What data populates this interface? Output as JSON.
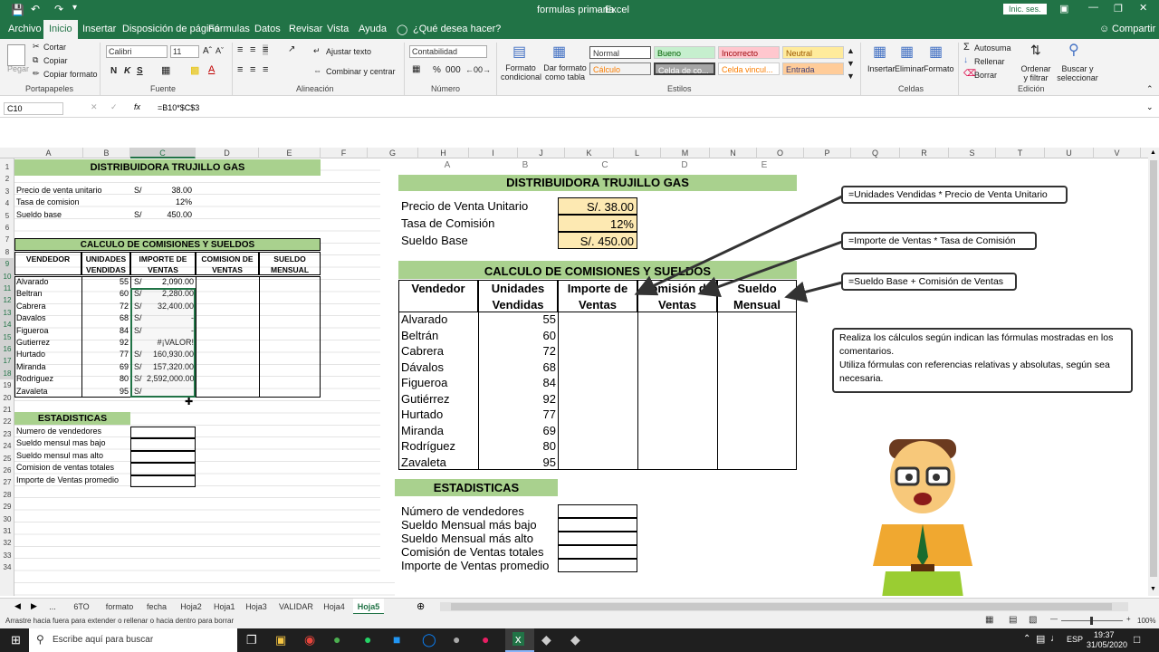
{
  "titlebar": {
    "doc_title": "formulas primaria",
    "sep": "-",
    "app": "Excel",
    "login": "Inic. ses.",
    "save_icon": "save-icon",
    "undo_icon": "undo-icon",
    "redo_icon": "redo-icon"
  },
  "menu": {
    "tabs": [
      "Archivo",
      "Inicio",
      "Insertar",
      "Disposición de página",
      "Fórmulas",
      "Datos",
      "Revisar",
      "Vista",
      "Ayuda"
    ],
    "tell": "¿Qué desea hacer?",
    "share": "Compartir"
  },
  "ribbon": {
    "clipboard": {
      "paste": "Pegar",
      "cut": "Cortar",
      "copy": "Copiar",
      "format_painter": "Copiar formato",
      "label": "Portapapeles"
    },
    "font": {
      "name": "Calibri",
      "size": "11",
      "label": "Fuente",
      "bold": "N",
      "italic": "K",
      "underline": "S"
    },
    "alignment": {
      "wrap": "Ajustar texto",
      "merge": "Combinar y centrar",
      "label": "Alineación"
    },
    "number": {
      "format": "Contabilidad",
      "label": "Número"
    },
    "styles": {
      "conditional": "Formato condicional",
      "table": "Dar formato como tabla",
      "normal": "Normal",
      "bueno": "Bueno",
      "incorrecto": "Incorrecto",
      "neutral": "Neutral",
      "calculo": "Cálculo",
      "celda_co": "Celda de co...",
      "celda_vinc": "Celda vincul...",
      "entrada": "Entrada",
      "label": "Estilos"
    },
    "cells": {
      "insert": "Insertar",
      "delete": "Eliminar",
      "format": "Formato",
      "label": "Celdas"
    },
    "editing": {
      "autosum": "Autosuma",
      "fill": "Rellenar",
      "clear": "Borrar",
      "sort": "Ordenar y filtrar",
      "find": "Buscar y seleccionar",
      "label": "Edición"
    }
  },
  "formula_bar": {
    "name_box": "C10",
    "fx": "fx",
    "formula": "=B10*$C$3"
  },
  "columns": [
    "A",
    "B",
    "C",
    "D",
    "E",
    "F",
    "G",
    "H",
    "I",
    "J",
    "K",
    "L",
    "M",
    "N",
    "O",
    "P",
    "Q",
    "R",
    "S",
    "T",
    "U",
    "V"
  ],
  "rows": [
    "1",
    "2",
    "3",
    "4",
    "5",
    "6",
    "7",
    "8",
    "9",
    "10",
    "11",
    "12",
    "13",
    "14",
    "15",
    "16",
    "17",
    "18",
    "19",
    "20",
    "21",
    "22",
    "23",
    "24",
    "25",
    "26",
    "27",
    "28",
    "29",
    "30",
    "31",
    "32",
    "33",
    "34"
  ],
  "sheet": {
    "title": "DISTRIBUIDORA TRUJILLO GAS",
    "params": [
      {
        "label": "Precio de  venta unitario",
        "cur": "S/",
        "value": "38.00"
      },
      {
        "label": "Tasa de comision",
        "cur": "",
        "value": "12%"
      },
      {
        "label": "Sueldo base",
        "cur": "S/",
        "value": "450.00"
      }
    ],
    "section_title": "CALCULO DE COMISIONES Y SUELDOS",
    "headers": [
      "VENDEDOR",
      "UNIDADES VENDIDAS",
      "IMPORTE DE VENTAS",
      "COMISION DE VENTAS",
      "SUELDO MENSUAL"
    ],
    "data": [
      {
        "name": "Alvarado",
        "units": "55",
        "cur": "S/",
        "amount": "2,090.00"
      },
      {
        "name": "Beltran",
        "units": "60",
        "cur": "S/",
        "amount": "2,280.00"
      },
      {
        "name": "Cabrera",
        "units": "72",
        "cur": "S/",
        "amount": "32,400.00"
      },
      {
        "name": "Davalos",
        "units": "68",
        "cur": "S/",
        "amount": "-"
      },
      {
        "name": "Figueroa",
        "units": "84",
        "cur": "S/",
        "amount": "-"
      },
      {
        "name": "Gutierrez",
        "units": "92",
        "cur": "",
        "amount": "#¡VALOR!"
      },
      {
        "name": "Hurtado",
        "units": "77",
        "cur": "S/",
        "amount": "160,930.00"
      },
      {
        "name": "Miranda",
        "units": "69",
        "cur": "S/",
        "amount": "157,320.00"
      },
      {
        "name": "Rodriguez",
        "units": "80",
        "cur": "S/",
        "amount": "2,592,000.00"
      },
      {
        "name": "Zavaleta",
        "units": "95",
        "cur": "S/",
        "amount": ""
      }
    ],
    "stats_title": "ESTADISTICAS",
    "stats": [
      "Numero de vendedores",
      "Sueldo mensul mas bajo",
      "Sueldo mensul mas alto",
      "Comision de ventas totales",
      "Importe de Ventas promedio"
    ]
  },
  "picture": {
    "col_letters": [
      "A",
      "B",
      "C",
      "D",
      "E"
    ],
    "title": "DISTRIBUIDORA TRUJILLO GAS",
    "params": [
      {
        "label": "Precio de Venta Unitario",
        "value": "S/. 38.00"
      },
      {
        "label": "Tasa de Comisión",
        "value": "12%"
      },
      {
        "label": "Sueldo Base",
        "value": "S/. 450.00"
      }
    ],
    "section_title": "CALCULO DE COMISIONES Y SUELDOS",
    "headers": [
      "Vendedor",
      "Unidades Vendidas",
      "Importe de Ventas",
      "Comisión de Ventas",
      "Sueldo Mensual"
    ],
    "data": [
      {
        "name": "Alvarado",
        "units": "55"
      },
      {
        "name": "Beltrán",
        "units": "60"
      },
      {
        "name": "Cabrera",
        "units": "72"
      },
      {
        "name": "Dávalos",
        "units": "68"
      },
      {
        "name": "Figueroa",
        "units": "84"
      },
      {
        "name": "Gutiérrez",
        "units": "92"
      },
      {
        "name": "Hurtado",
        "units": "77"
      },
      {
        "name": "Miranda",
        "units": "69"
      },
      {
        "name": "Rodríguez",
        "units": "80"
      },
      {
        "name": "Zavaleta",
        "units": "95"
      }
    ],
    "stats_title": "ESTADISTICAS",
    "stats": [
      "Número de vendedores",
      "Sueldo Mensual más bajo",
      "Sueldo Mensual más alto",
      "Comisión de Ventas totales",
      "Importe de Ventas promedio"
    ],
    "comments": [
      "=Unidades Vendidas * Precio de Venta Unitario",
      "=Importe de Ventas * Tasa de Comisión",
      "=Sueldo Base + Comisión de Ventas"
    ],
    "instructions": "Realiza los cálculos según indican las fórmulas mostradas en los comentarios.\nUtiliza fórmulas con referencias relativas y absolutas, según sea necesaria."
  },
  "sheet_tabs": [
    "...",
    "6TO",
    "formato",
    "fecha",
    "Hoja2",
    "Hoja1",
    "Hoja3",
    "VALIDAR",
    "Hoja4",
    "Hoja5"
  ],
  "active_tab": "Hoja5",
  "status": {
    "message": "Arrastre hacia fuera para extender o rellenar o hacia dentro para borrar",
    "zoom": "100%"
  },
  "taskbar": {
    "search": "Escribe aquí para buscar",
    "time": "19:37",
    "date": "31/05/2020",
    "lang": "ESP"
  },
  "colors": {
    "excel_green": "#217346",
    "table_green": "#a9d18e",
    "param_fill": "#fde9b2"
  }
}
